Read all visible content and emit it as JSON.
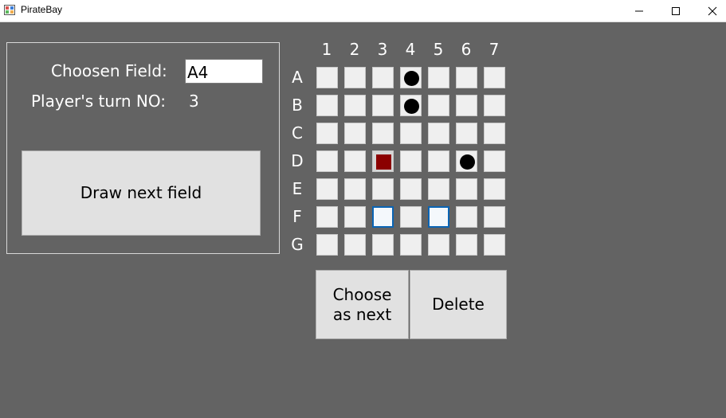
{
  "window": {
    "title": "PirateBay"
  },
  "panel": {
    "chosen_label": "Choosen Field:",
    "chosen_value": "A4",
    "turn_label": "Player's turn NO:",
    "turn_value": "3",
    "draw_button": "Draw next field"
  },
  "board": {
    "columns": [
      "1",
      "2",
      "3",
      "4",
      "5",
      "6",
      "7"
    ],
    "rows": [
      "A",
      "B",
      "C",
      "D",
      "E",
      "F",
      "G"
    ],
    "tokens": [
      "A4",
      "B4",
      "D6"
    ],
    "red_fields": [
      "D3"
    ],
    "selected_fields": [
      "F3",
      "F5"
    ]
  },
  "actions": {
    "choose_label_line1": "Choose",
    "choose_label_line2": "as next",
    "delete_label": "Delete"
  },
  "colors": {
    "background": "#636363",
    "token": "#000000",
    "red_field": "#8b0000",
    "selection_border": "#0a64b4"
  }
}
